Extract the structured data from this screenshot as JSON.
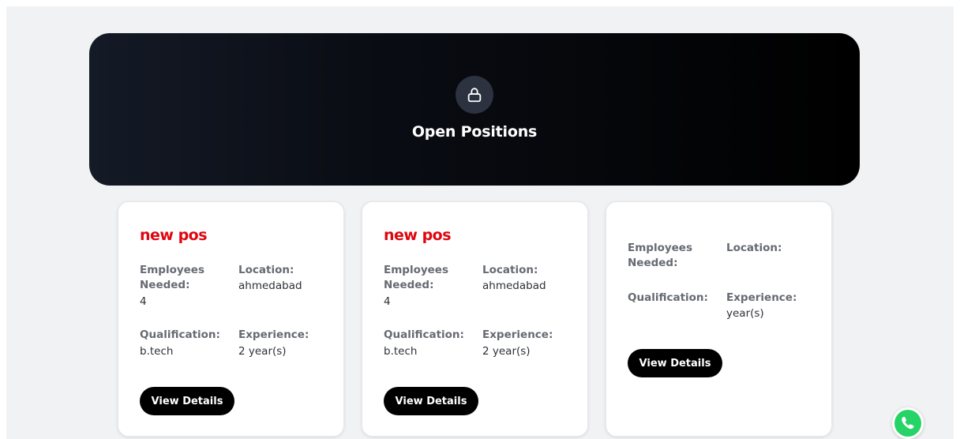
{
  "hero": {
    "title": "Open Positions",
    "icon": "lock-icon"
  },
  "cards": [
    {
      "title": "new pos",
      "employees_label": "Employees Needed:",
      "employees_value": "4",
      "location_label": "Location:",
      "location_value": "ahmedabad",
      "qualification_label": "Qualification:",
      "qualification_value": "b.tech",
      "experience_label": "Experience:",
      "experience_value": "2 year(s)",
      "button_label": "View Details"
    },
    {
      "title": "new pos",
      "employees_label": "Employees Needed:",
      "employees_value": "4",
      "location_label": "Location:",
      "location_value": "ahmedabad",
      "qualification_label": "Qualification:",
      "qualification_value": "b.tech",
      "experience_label": "Experience:",
      "experience_value": "2 year(s)",
      "button_label": "View Details"
    },
    {
      "title": "",
      "employees_label": "Employees Needed:",
      "employees_value": "",
      "location_label": "Location:",
      "location_value": "",
      "qualification_label": "Qualification:",
      "qualification_value": "",
      "experience_label": "Experience:",
      "experience_value": "year(s)",
      "button_label": "View Details"
    }
  ],
  "colors": {
    "accent": "#e0060f",
    "button": "#000000",
    "whatsapp": "#25d366"
  },
  "floating": {
    "icon": "whatsapp-icon"
  }
}
